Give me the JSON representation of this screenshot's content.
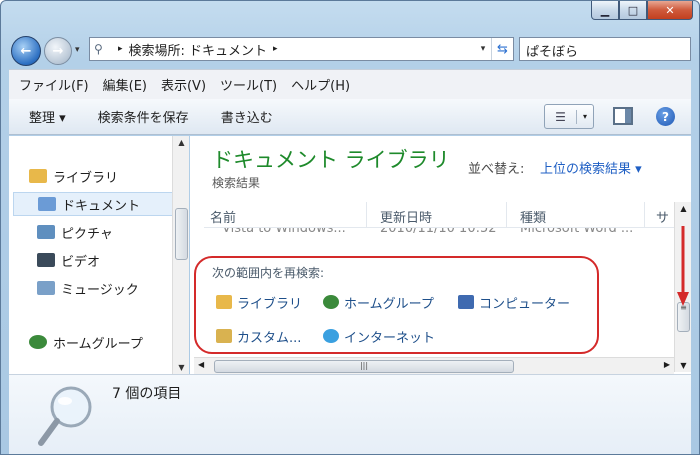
{
  "window": {
    "min_label": "▁",
    "max_label": "□",
    "close_label": "✕"
  },
  "address": {
    "prefix": "▸",
    "location_label": "検索場所: ドキュメント",
    "suffix": "▸"
  },
  "search": {
    "value": "ぱそぼら"
  },
  "menu": [
    "ファイル(F)",
    "編集(E)",
    "表示(V)",
    "ツール(T)",
    "ヘルプ(H)"
  ],
  "toolbar": {
    "organize": "整理 ▾",
    "save_search": "検索条件を保存",
    "burn": "書き込む",
    "help": "?"
  },
  "nav": {
    "items": [
      {
        "label": "ライブラリ",
        "icon": "library-icon",
        "color": "#e8b84a"
      },
      {
        "label": "ドキュメント",
        "icon": "documents-icon",
        "color": "#6b9bd6"
      },
      {
        "label": "ピクチャ",
        "icon": "pictures-icon",
        "color": "#5f8fbf"
      },
      {
        "label": "ビデオ",
        "icon": "video-icon",
        "color": "#3a4a5a"
      },
      {
        "label": "ミュージック",
        "icon": "music-icon",
        "color": "#7aa0c8"
      },
      {
        "label": "ホームグループ",
        "icon": "homegroup-icon",
        "color": "#3b8a3b"
      }
    ]
  },
  "content": {
    "title": "ドキュメント ライブラリ",
    "subtitle": "検索結果",
    "sort_label": "並べ替え:",
    "sort_value": "上位の検索結果 ▾",
    "columns": [
      "名前",
      "更新日時",
      "種類",
      "サ"
    ],
    "partial_row": [
      "Vista to Windows...",
      "2010/11/10 10:52",
      "Microsoft Word ..."
    ],
    "research_label": "次の範囲内を再検索:",
    "research_items": [
      {
        "label": "ライブラリ",
        "icon": "library-icon",
        "color": "#e8b84a"
      },
      {
        "label": "ホームグループ",
        "icon": "homegroup-icon",
        "color": "#3b8a3b"
      },
      {
        "label": "コンピューター",
        "icon": "computer-icon",
        "color": "#3f6ab0"
      },
      {
        "label": "カスタム...",
        "icon": "custom-folder-icon",
        "color": "#d9b250"
      },
      {
        "label": "インターネット",
        "icon": "internet-explorer-icon",
        "color": "#3aa0e0"
      }
    ]
  },
  "details": {
    "count": "7 個の項目"
  },
  "accent": {
    "annotation_red": "#d42a2a",
    "title_green": "#1e8a2b"
  }
}
